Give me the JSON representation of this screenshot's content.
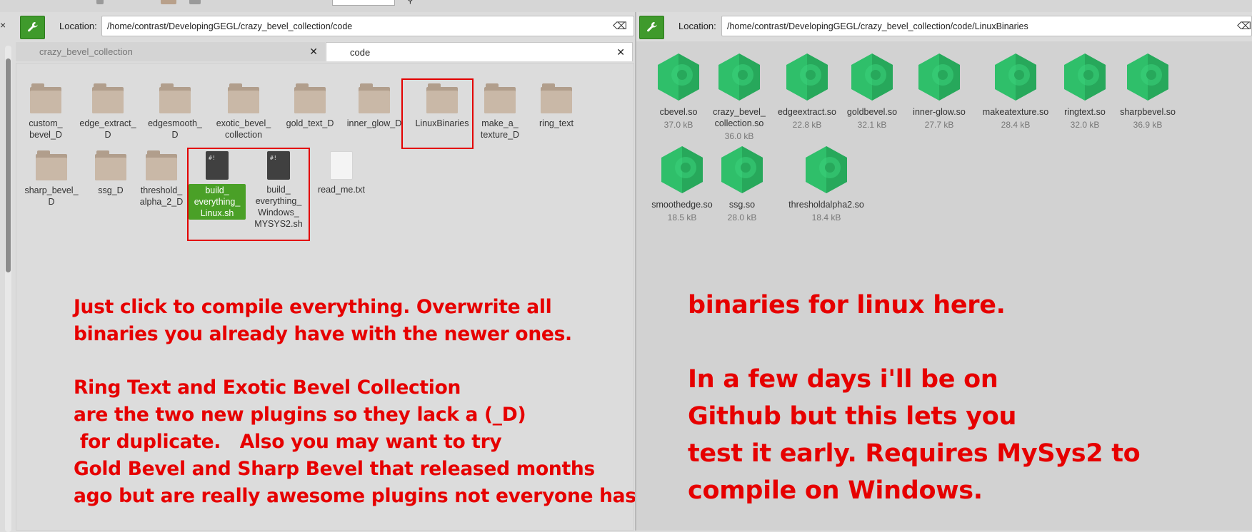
{
  "left": {
    "location_label": "Location:",
    "location_path": "/home/contrast/DevelopingGEGL/crazy_bevel_collection/code",
    "tabs": [
      {
        "label": "crazy_bevel_collection",
        "active": false
      },
      {
        "label": "code",
        "active": true
      }
    ],
    "items": [
      {
        "name": "custom_\nbevel_D",
        "type": "folder"
      },
      {
        "name": "edge_extract_\nD",
        "type": "folder"
      },
      {
        "name": "edgesmooth_\nD",
        "type": "folder"
      },
      {
        "name": "exotic_bevel_\ncollection",
        "type": "folder"
      },
      {
        "name": "gold_text_D",
        "type": "folder"
      },
      {
        "name": "inner_glow_D",
        "type": "folder"
      },
      {
        "name": "LinuxBinaries",
        "type": "folder"
      },
      {
        "name": "make_a_\ntexture_D",
        "type": "folder"
      },
      {
        "name": "ring_text",
        "type": "folder"
      },
      {
        "name": "sharp_bevel_\nD",
        "type": "folder"
      },
      {
        "name": "ssg_D",
        "type": "folder"
      },
      {
        "name": "threshold_\nalpha_2_D",
        "type": "folder"
      },
      {
        "name": "build_\neverything_\nLinux.sh",
        "type": "script",
        "selected": true
      },
      {
        "name": "build_\neverything_\nWindows_\nMYSYS2.sh",
        "type": "script"
      },
      {
        "name": "read_me.txt",
        "type": "text"
      }
    ],
    "note": "Just click to compile everything. Overwrite all\nbinaries you already have with the newer ones.\n\nRing Text and Exotic Bevel Collection\nare the two new plugins so they lack a (_D)\n for duplicate.   Also you may want to try\nGold Bevel and Sharp Bevel that released months\nago but are really awesome plugins not everyone has."
  },
  "right": {
    "location_label": "Location:",
    "location_path": "/home/contrast/DevelopingGEGL/crazy_bevel_collection/code/LinuxBinaries",
    "items": [
      {
        "name": "cbevel.so",
        "size": "37.0 kB"
      },
      {
        "name": "crazy_bevel_\ncollection.so",
        "size": "36.0 kB"
      },
      {
        "name": "edgeextract.so",
        "size": "22.8 kB"
      },
      {
        "name": "goldbevel.so",
        "size": "32.1 kB"
      },
      {
        "name": "inner-glow.so",
        "size": "27.7 kB"
      },
      {
        "name": "makeatexture.so",
        "size": "28.4 kB"
      },
      {
        "name": "ringtext.so",
        "size": "32.0 kB"
      },
      {
        "name": "sharpbevel.so",
        "size": "36.9 kB"
      },
      {
        "name": "smoothedge.so",
        "size": "18.5 kB"
      },
      {
        "name": "ssg.so",
        "size": "28.0 kB"
      },
      {
        "name": "thresholdalpha2.so",
        "size": "18.4 kB"
      }
    ],
    "note": "binaries for linux here.\n\nIn a few days i'll be on\nGithub but this lets you\ntest it early. Requires MySys2 to\ncompile on Windows."
  },
  "icons": {
    "location_toggle": "wrench-icon",
    "clear": "backspace-icon",
    "tab_close": "close-icon"
  },
  "colors": {
    "accent": "#3f9a2c",
    "annotation": "#e60000",
    "folder": "#c9b8a7",
    "library": "#2fbf6a"
  }
}
